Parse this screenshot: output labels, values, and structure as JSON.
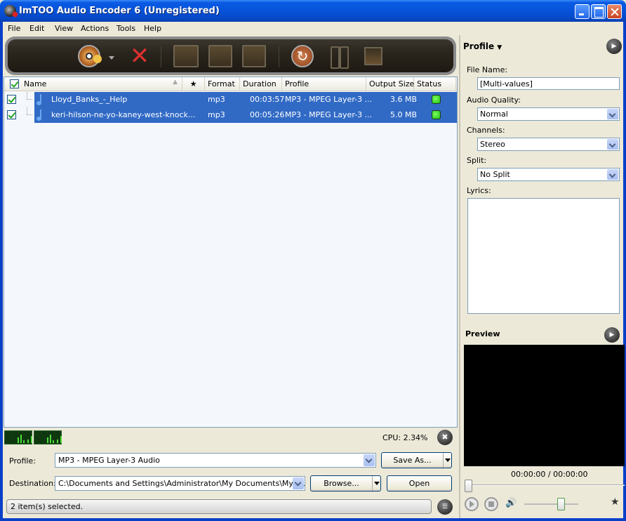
{
  "window": {
    "title": "ImTOO Audio Encoder 6 (Unregistered)",
    "controls": [
      "minimize",
      "maximize",
      "close"
    ]
  },
  "menu": [
    "File",
    "Edit",
    "View",
    "Actions",
    "Tools",
    "Help"
  ],
  "toolbar": {
    "buttons": [
      {
        "name": "add-file",
        "icon": "disc-music-icon",
        "has_dropdown": true
      },
      {
        "name": "remove",
        "icon": "red-x-icon"
      },
      {
        "name": "clip",
        "icon": "scissors-film-icon"
      },
      {
        "name": "effects",
        "icon": "film-stars-icon"
      },
      {
        "name": "merge",
        "icon": "film-arrow-icon"
      },
      {
        "name": "convert",
        "icon": "refresh-circle-icon"
      },
      {
        "name": "pause",
        "icon": "pause-icon"
      },
      {
        "name": "stop",
        "icon": "stop-icon"
      }
    ]
  },
  "file_list": {
    "columns": [
      "Name",
      "★",
      "Format",
      "Duration",
      "Profile",
      "Output Size",
      "Status"
    ],
    "rows": [
      {
        "checked": true,
        "name": "Lloyd_Banks_-_Help",
        "format": "mp3",
        "duration": "00:03:57",
        "profile": "MP3 - MPEG Layer-3 ...",
        "output_size": "3.6 MB",
        "status": "ready",
        "selected": true
      },
      {
        "checked": true,
        "name": "keri-hilson-ne-yo-kaney-west-knock...",
        "format": "mp3",
        "duration": "00:05:26",
        "profile": "MP3 - MPEG Layer-3 ...",
        "output_size": "5.0 MB",
        "status": "ready",
        "selected": true
      }
    ]
  },
  "cpu": "CPU: 2.34%",
  "bottom": {
    "profile_label": "Profile:",
    "profile_value": "MP3 - MPEG Layer-3 Audio",
    "save_as": "Save As...",
    "destination_label": "Destination:",
    "destination_value": "C:\\Documents and Settings\\Administrator\\My Documents\\My Music",
    "browse": "Browse...",
    "open": "Open",
    "status": "2 item(s) selected."
  },
  "profile_panel": {
    "title": "Profile",
    "file_name_label": "File Name:",
    "file_name_value": "[Multi-values]",
    "audio_quality_label": "Audio Quality:",
    "audio_quality_value": "Normal",
    "channels_label": "Channels:",
    "channels_value": "Stereo",
    "split_label": "Split:",
    "split_value": "No Split",
    "lyrics_label": "Lyrics:",
    "lyrics_value": ""
  },
  "preview": {
    "title": "Preview",
    "time": "00:00:00 / 00:00:00",
    "seek_position": 0,
    "volume": 0.7
  }
}
